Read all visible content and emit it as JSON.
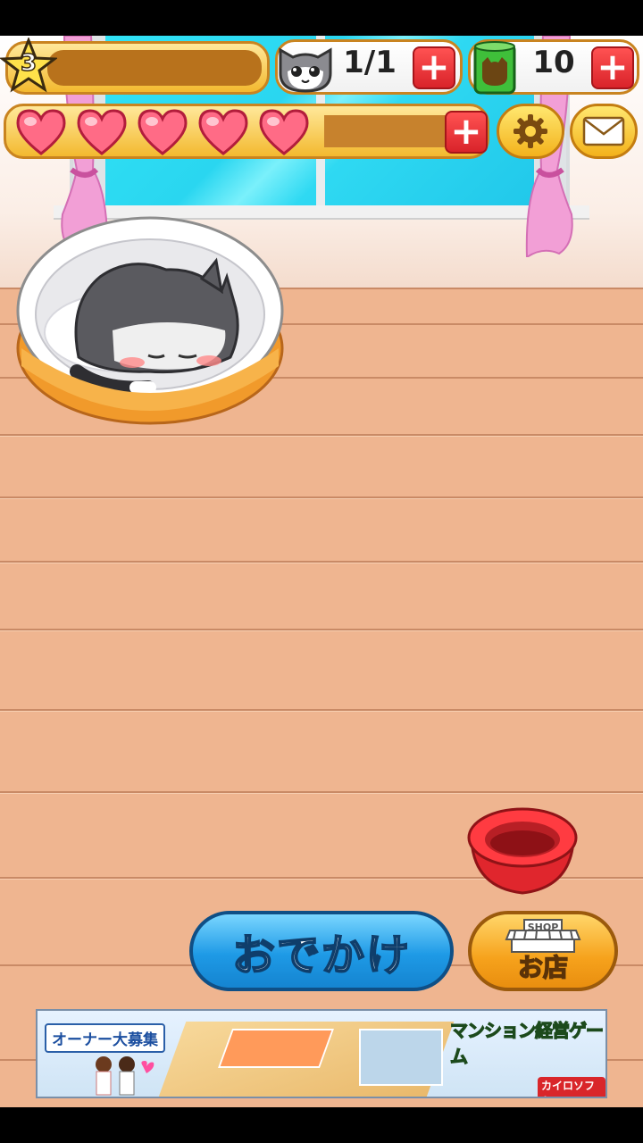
{
  "hud": {
    "level": "3",
    "cats_count": "1/1",
    "food_count": "10",
    "hearts": 5
  },
  "buttons": {
    "outing_label": "おでかけ",
    "shop_label": "お店",
    "shop_sign": "SHOP"
  },
  "ad": {
    "left_tag": "オーナー大募集",
    "title": "マンション経営ゲーム",
    "brand": "カイロソフト"
  },
  "colors": {
    "floor": "#efb590",
    "window_glass": "#2ad6f0",
    "curtain": "#f29fd6",
    "outing_button": "#2ba6e8",
    "shop_button": "#f6a21c",
    "plus_button": "#e8262d"
  }
}
